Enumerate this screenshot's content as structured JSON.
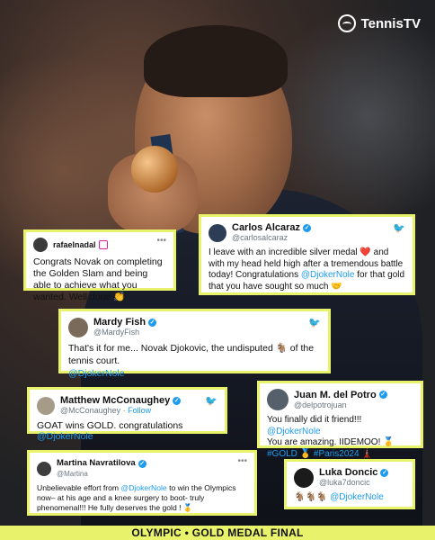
{
  "brand": {
    "logo_text": "TennisTV",
    "accent": "#e9f26b"
  },
  "posts": [
    {
      "name": "rafaelnadal",
      "handle": "",
      "text": "Congrats Novak on completing the Golden Slam and being able to achieve what you wanted. Well done 👏",
      "platform": "instagram"
    },
    {
      "name": "Carlos Alcaraz",
      "handle": "@carlosalcaraz",
      "text_a": "I leave with an incredible silver medal ❤️ and with my head held high after a tremendous battle today! Congratulations ",
      "mention": "@DjokerNole",
      "text_b": " for that gold that you have sought so much 🤝"
    },
    {
      "name": "Mardy Fish",
      "handle": "@MardyFish",
      "text": "That's it for me... Novak Djokovic, the undisputed 🐐 of the tennis court.",
      "mention": "@DjokerNole"
    },
    {
      "name": "Matthew McConaughey",
      "handle": "@McConaughey",
      "follow": "Follow",
      "text": "GOAT wins GOLD. congratulations ",
      "mention": "@DjokerNole"
    },
    {
      "name": "Juan M. del Potro",
      "handle": "@delpotrojuan",
      "text_a": "You finally did it friend!!! ",
      "mention": "@DjokerNole",
      "text_b": "You are amazing. IIDEMOO! 🥇",
      "tags": "#GOLD 🥇 #Paris2024 🗼"
    },
    {
      "name": "Martina Navratilova",
      "handle": "@Martina",
      "text_a": "Unbelievable effort from ",
      "mention": "@DjokerNole",
      "text_b": " to win the Olympics now– at his age and a knee surgery to boot- truly phenomenal!!! He fully deserves the gold ! 🥇"
    },
    {
      "name": "Luka Doncic",
      "handle": "@luka7doncic",
      "text_a": "🐐🐐🐐 ",
      "mention": "@DjokerNole"
    }
  ],
  "banner": {
    "text": "OLYMPIC • GOLD MEDAL FINAL"
  }
}
